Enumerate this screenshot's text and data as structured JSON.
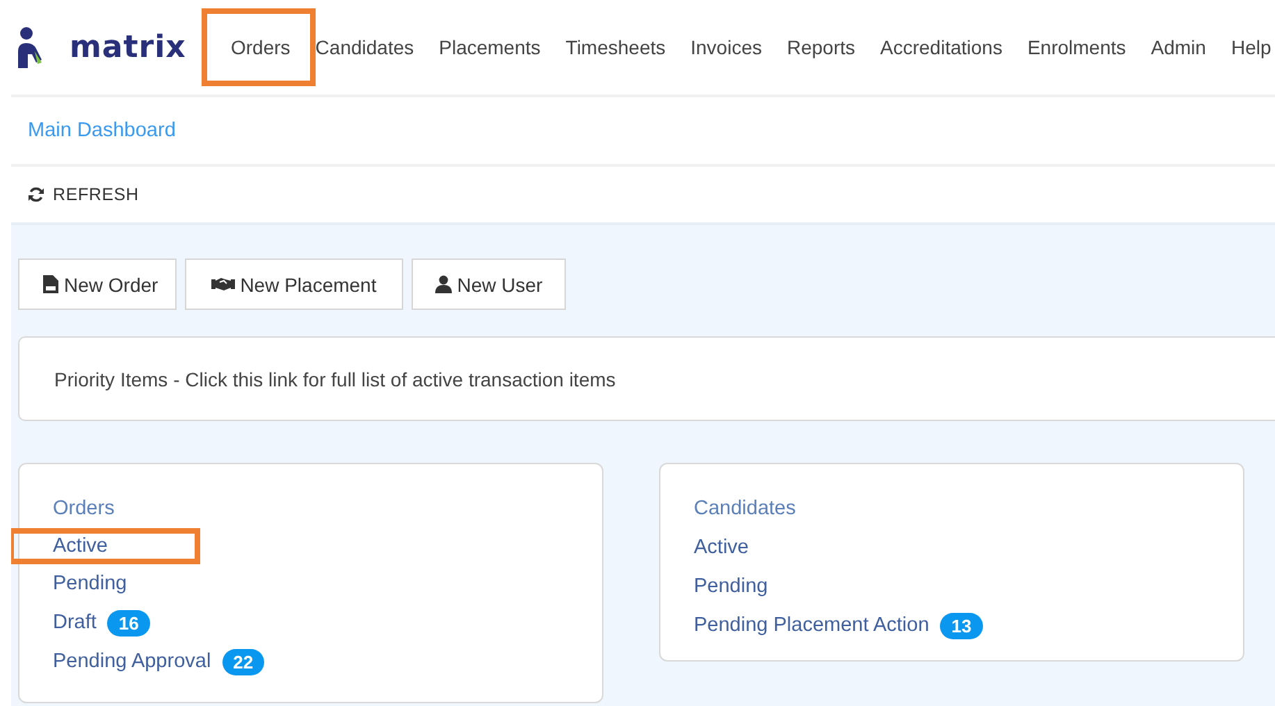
{
  "brand": {
    "name": "matrix"
  },
  "nav": [
    {
      "label": "Orders",
      "highlighted": true
    },
    {
      "label": "Candidates",
      "highlighted": false
    },
    {
      "label": "Placements",
      "highlighted": false
    },
    {
      "label": "Timesheets",
      "highlighted": false
    },
    {
      "label": "Invoices",
      "highlighted": false
    },
    {
      "label": "Reports",
      "highlighted": false
    },
    {
      "label": "Accreditations",
      "highlighted": false
    },
    {
      "label": "Enrolments",
      "highlighted": false
    },
    {
      "label": "Admin",
      "highlighted": false
    },
    {
      "label": "Help",
      "highlighted": false
    }
  ],
  "breadcrumb": "Main Dashboard",
  "toolbar": {
    "refresh": "REFRESH"
  },
  "actions": [
    {
      "label": "New Order",
      "kind": "order"
    },
    {
      "label": "New Placement",
      "kind": "placement"
    },
    {
      "label": "New User",
      "kind": "user"
    }
  ],
  "priority": "Priority Items - Click this link for full list of active transaction items",
  "panels": [
    {
      "items": [
        {
          "label": "Orders",
          "kind": "heading",
          "highlighted": false
        },
        {
          "label": "Active",
          "kind": "link",
          "highlighted": true
        },
        {
          "label": "Pending",
          "kind": "link",
          "highlighted": false
        },
        {
          "label": "Draft",
          "kind": "link",
          "count": "16",
          "highlighted": false
        },
        {
          "label": "Pending Approval",
          "kind": "link",
          "count": "22",
          "highlighted": false
        }
      ]
    },
    {
      "items": [
        {
          "label": "Candidates",
          "kind": "heading",
          "highlighted": false
        },
        {
          "label": "Active",
          "kind": "link",
          "highlighted": false
        },
        {
          "label": "Pending",
          "kind": "link",
          "highlighted": false
        },
        {
          "label": "Pending Placement Action",
          "kind": "link",
          "count": "13",
          "highlighted": false
        }
      ]
    }
  ]
}
